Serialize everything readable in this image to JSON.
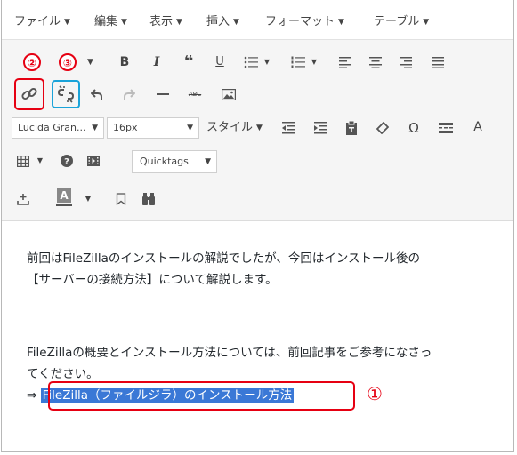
{
  "menubar": {
    "items": [
      {
        "label": "ファイル"
      },
      {
        "label": "編集"
      },
      {
        "label": "表示"
      },
      {
        "label": "挿入"
      },
      {
        "label": "フォーマット"
      },
      {
        "label": "テーブル"
      }
    ]
  },
  "toolbar": {
    "row1": {
      "format_label": "",
      "buttons": [
        {
          "icon": "bold-icon",
          "glyph": "B"
        },
        {
          "icon": "italic-icon",
          "glyph": "I"
        },
        {
          "icon": "blockquote-icon",
          "glyph": "❝"
        },
        {
          "icon": "underline-icon",
          "glyph": "U"
        },
        {
          "icon": "bullet-list-icon"
        },
        {
          "icon": "numbered-list-icon"
        },
        {
          "icon": "align-left-icon"
        },
        {
          "icon": "align-center-icon"
        },
        {
          "icon": "align-right-icon"
        },
        {
          "icon": "align-justify-icon"
        }
      ]
    },
    "row2": {
      "buttons": [
        "link-icon",
        "unlink-icon",
        "undo-icon",
        "redo-icon",
        "horizontal-line-icon",
        "strikethrough-icon",
        "image-icon"
      ],
      "strike_text": "ABC"
    },
    "row3": {
      "font_family": "Lucida Gran...",
      "font_size": "16px",
      "style_label": "スタイル",
      "icons": [
        "outdent-icon",
        "indent-icon",
        "paste-text-icon",
        "clear-format-icon",
        "omega-icon",
        "more-icon",
        "text-color-icon"
      ],
      "omega_glyph": "Ω",
      "text_color_glyph": "A"
    },
    "row4": {
      "quicktags_label": "Quicktags",
      "icons": [
        "table-icon",
        "help-icon",
        "media-icon"
      ]
    },
    "row5": {
      "icons": [
        "anchor-add-icon",
        "background-color-icon",
        "bookmark-icon",
        "find-icon"
      ],
      "bg_color_glyph": "A"
    }
  },
  "annotations": {
    "num1": "①",
    "num2": "②",
    "num3": "③"
  },
  "content": {
    "p1_line1": "前回はFileZillaのインストールの解説でしたが、今回はインストール後の",
    "p1_line2": "【サーバーの接続方法】について解説します。",
    "p2_line1": "FileZillaの概要とインストール方法については、前回記事をご参考になさっ",
    "p2_line2": "てください。",
    "arrow": "⇒",
    "link_text": "FileZilla（ファイルジラ）のインストール方法"
  },
  "colors": {
    "annotation_red": "#e60012",
    "annotation_blue": "#1aa3d9",
    "selection": "#3a78d6"
  }
}
